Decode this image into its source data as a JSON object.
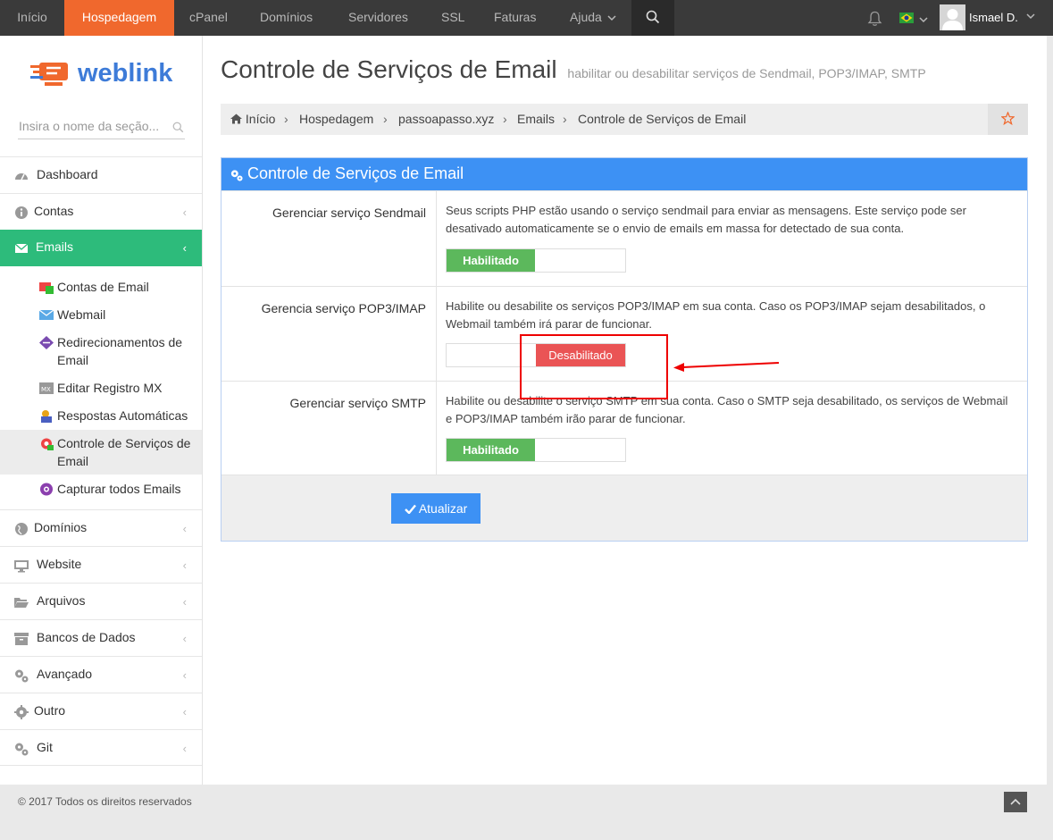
{
  "topnav": {
    "items": [
      "Início",
      "Hospedagem",
      "cPanel",
      "Domínios",
      "Servidores",
      "SSL",
      "Faturas",
      "Ajuda"
    ],
    "user_name": "Ismael D.",
    "accent_color": "#f0682d"
  },
  "sidebar": {
    "logo_text": "weblink",
    "search_placeholder": "Insira o nome da seção...",
    "items": [
      {
        "label": "Dashboard",
        "icon": "dashboard-icon"
      },
      {
        "label": "Contas",
        "icon": "info-icon"
      },
      {
        "label": "Emails",
        "icon": "envelope-icon"
      },
      {
        "label": "Domínios",
        "icon": "globe-icon"
      },
      {
        "label": "Website",
        "icon": "monitor-icon"
      },
      {
        "label": "Arquivos",
        "icon": "folder-icon"
      },
      {
        "label": "Bancos de Dados",
        "icon": "archive-icon"
      },
      {
        "label": "Avançado",
        "icon": "cogs-icon"
      },
      {
        "label": "Outro",
        "icon": "gear-icon"
      },
      {
        "label": "Git",
        "icon": "cogs-icon"
      }
    ],
    "email_subitems": [
      "Contas de Email",
      "Webmail",
      "Redirecionamentos de Email",
      "Editar Registro MX",
      "Respostas Automáticas",
      "Controle de Serviços de Email",
      "Capturar todos Emails"
    ],
    "active_color": "#2dbb7b"
  },
  "page": {
    "title": "Controle de Serviços de Email",
    "subtitle": "habilitar ou desabilitar serviços de Sendmail, POP3/IMAP, SMTP",
    "breadcrumb": [
      "Início",
      "Hospedagem",
      "passoapasso.xyz",
      "Emails",
      "Controle de Serviços de Email"
    ]
  },
  "panel": {
    "heading": "Controle de Serviços de Email",
    "rows": [
      {
        "label": "Gerenciar serviço Sendmail",
        "description": "Seus scripts PHP estão usando o serviço sendmail para enviar as mensagens. Este serviço pode ser desativado automaticamente se o envio de emails em massa for detectado de sua conta.",
        "state": "Habilitado"
      },
      {
        "label": "Gerencia serviço POP3/IMAP",
        "description": "Habilite ou desabilite os serviços POP3/IMAP em sua conta. Caso os POP3/IMAP sejam desabilitados, o Webmail também irá parar de funcionar.",
        "state": "Desabilitado"
      },
      {
        "label": "Gerenciar serviço SMTP",
        "description": "Habilite ou desabilite o serviço SMTP em sua conta. Caso o SMTP seja desabilitado, os serviços de Webmail e POP3/IMAP também irão parar de funcionar.",
        "state": "Habilitado"
      }
    ],
    "update_button": "Atualizar",
    "header_color": "#3d91f4",
    "enabled_color": "#5cb85c",
    "disabled_color": "#ea5455"
  },
  "footer": {
    "copyright": "© 2017 Todos os direitos reservados"
  }
}
